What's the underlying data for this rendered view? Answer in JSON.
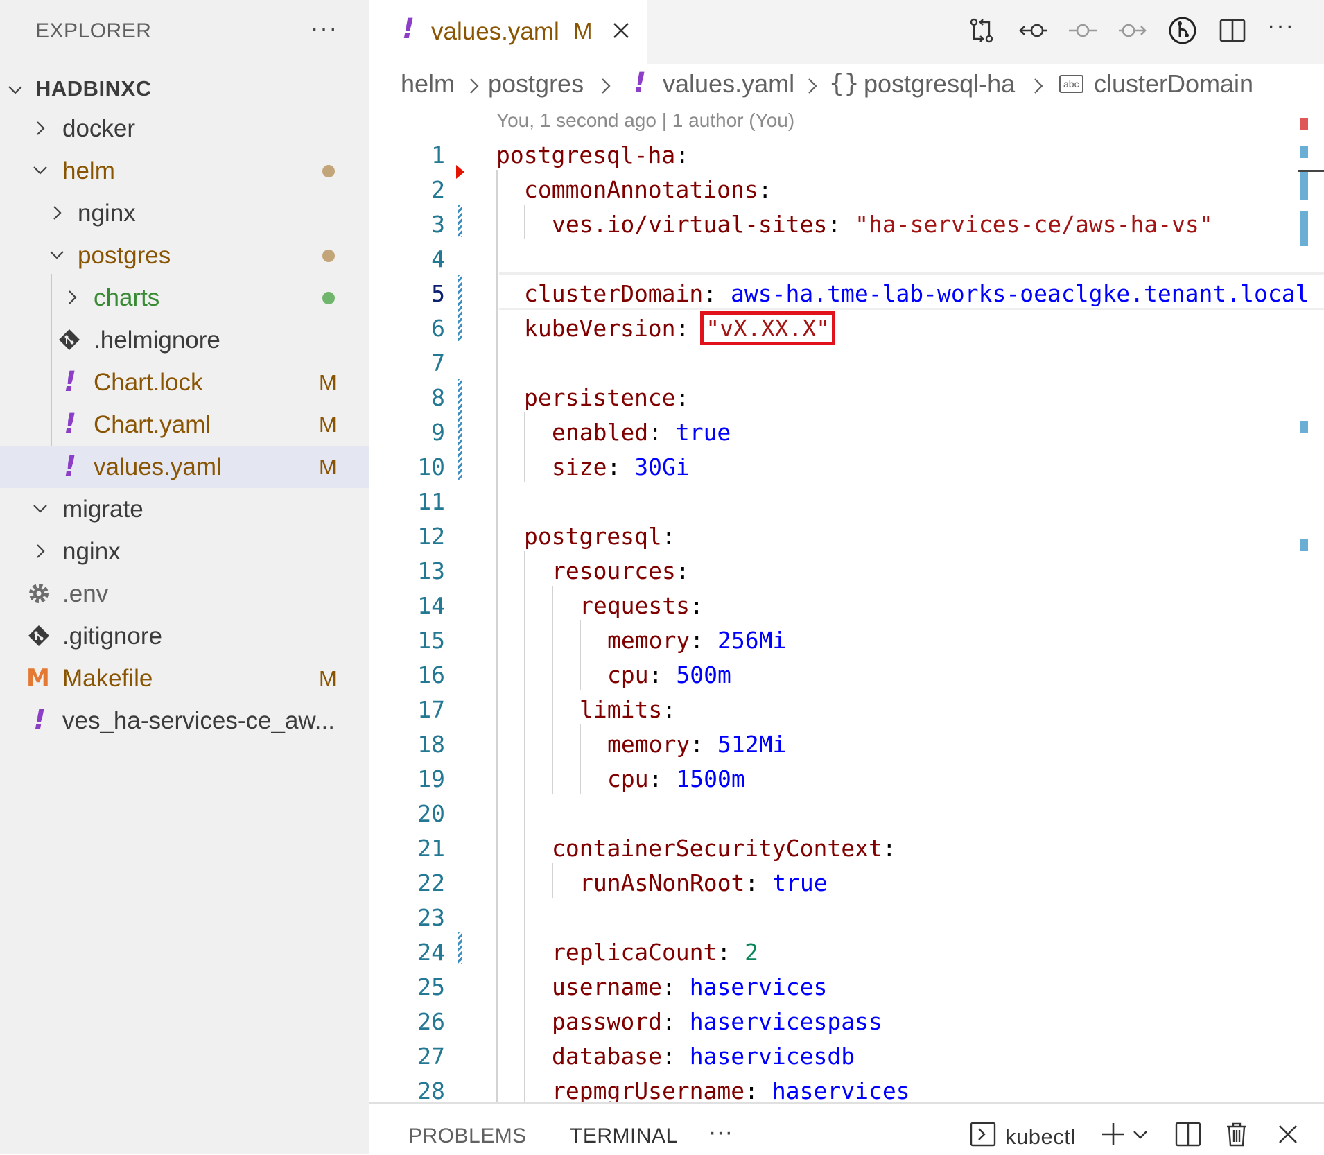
{
  "explorer": {
    "title": "EXPLORER",
    "more": "···",
    "root": "HADBINXC",
    "items": [
      {
        "label": "docker"
      },
      {
        "label": "helm"
      },
      {
        "label": "nginx"
      },
      {
        "label": "postgres"
      },
      {
        "label": "charts"
      },
      {
        "label": ".helmignore"
      },
      {
        "label": "Chart.lock",
        "badge": "M",
        "icon": "!"
      },
      {
        "label": "Chart.yaml",
        "badge": "M",
        "icon": "!"
      },
      {
        "label": "values.yaml",
        "badge": "M",
        "icon": "!"
      },
      {
        "label": "migrate"
      },
      {
        "label": "nginx"
      },
      {
        "label": ".env"
      },
      {
        "label": ".gitignore"
      },
      {
        "label": "Makefile",
        "badge": "M",
        "icon": "M"
      },
      {
        "label": "ves_ha-services-ce_aw...",
        "icon": "!"
      }
    ]
  },
  "tab": {
    "icon": "!",
    "name": "values.yaml",
    "mark": "M"
  },
  "toolbar": {
    "more": "···"
  },
  "breadcrumb": {
    "items": [
      "helm",
      "postgres",
      "!",
      "values.yaml",
      "{}",
      "postgresql-ha",
      "abc",
      "clusterDomain"
    ]
  },
  "blame": "You, 1 second ago | 1 author (You)",
  "code": {
    "line_numbers": [
      "1",
      "2",
      "3",
      "4",
      "5",
      "6",
      "7",
      "8",
      "9",
      "10",
      "11",
      "12",
      "13",
      "14",
      "15",
      "16",
      "17",
      "18",
      "19",
      "20",
      "21",
      "22",
      "23",
      "24",
      "25",
      "26",
      "27",
      "28"
    ],
    "l1": {
      "key": "postgresql-ha",
      "colon": ":"
    },
    "l2": {
      "key": "commonAnnotations",
      "colon": ":"
    },
    "l3": {
      "key": "ves.io/virtual-sites",
      "colon": ":",
      "value": "\"ha-services-ce/aws-ha-vs\""
    },
    "l5": {
      "key": "clusterDomain",
      "colon": ":",
      "value": "aws-ha.tme-lab-works-oeaclgke.tenant.local"
    },
    "l6": {
      "key": "kubeVersion",
      "colon": ":",
      "value": "\"vX.XX.X\""
    },
    "l8": {
      "key": "persistence",
      "colon": ":"
    },
    "l9": {
      "key": "enabled",
      "colon": ":",
      "value": "true"
    },
    "l10": {
      "key": "size",
      "colon": ":",
      "value": "30Gi"
    },
    "l12": {
      "key": "postgresql",
      "colon": ":"
    },
    "l13": {
      "key": "resources",
      "colon": ":"
    },
    "l14": {
      "key": "requests",
      "colon": ":"
    },
    "l15": {
      "key": "memory",
      "colon": ":",
      "value": "256Mi"
    },
    "l16": {
      "key": "cpu",
      "colon": ":",
      "value": "500m"
    },
    "l17": {
      "key": "limits",
      "colon": ":"
    },
    "l18": {
      "key": "memory",
      "colon": ":",
      "value": "512Mi"
    },
    "l19": {
      "key": "cpu",
      "colon": ":",
      "value": "1500m"
    },
    "l21": {
      "key": "containerSecurityContext",
      "colon": ":"
    },
    "l22": {
      "key": "runAsNonRoot",
      "colon": ":",
      "value": "true"
    },
    "l24": {
      "key": "replicaCount",
      "colon": ":",
      "value": "2"
    },
    "l25": {
      "key": "username",
      "colon": ":",
      "value": "haservices"
    },
    "l26": {
      "key": "password",
      "colon": ":",
      "value": "haservicespass"
    },
    "l27": {
      "key": "database",
      "colon": ":",
      "value": "haservicesdb"
    },
    "l28": {
      "key": "repmgrUsername",
      "colon": ":",
      "value": "haservices"
    }
  },
  "panel": {
    "problems": "PROBLEMS",
    "terminal": "TERMINAL",
    "more": "···",
    "terminal_name": "kubectl"
  },
  "colors": {
    "modified": "#895503",
    "untracked": "#388a34",
    "key": "#800000",
    "string": "#a31515",
    "value": "#0000ff",
    "number": "#098658",
    "highlight_box": "#e0121b"
  }
}
